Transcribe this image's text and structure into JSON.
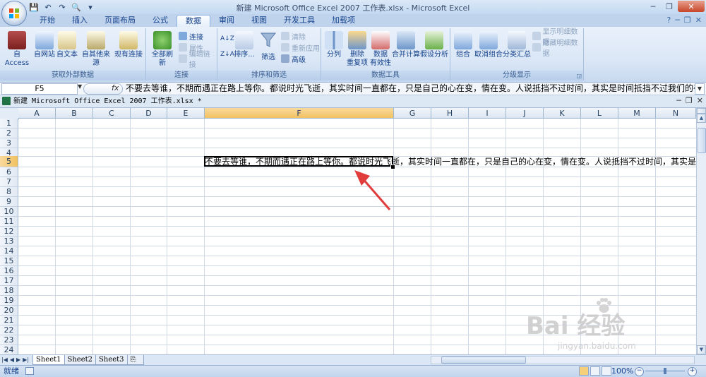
{
  "window": {
    "title": "新建 Microsoft Office Excel 2007 工作表.xlsx - Microsoft Excel",
    "minimize": "─",
    "maximize": "❐",
    "close": "✕"
  },
  "quick_access": [
    "💾",
    "↶",
    "↷",
    "🔍",
    "▾"
  ],
  "tabs": [
    {
      "label": "开始",
      "active": false
    },
    {
      "label": "插入",
      "active": false
    },
    {
      "label": "页面布局",
      "active": false
    },
    {
      "label": "公式",
      "active": false
    },
    {
      "label": "数据",
      "active": true
    },
    {
      "label": "审阅",
      "active": false
    },
    {
      "label": "视图",
      "active": false
    },
    {
      "label": "开发工具",
      "active": false
    },
    {
      "label": "加载项",
      "active": false
    }
  ],
  "help_icons": {
    "help": "?",
    "min": "─",
    "restore": "❐",
    "close": "✕"
  },
  "ribbon": {
    "get_external": {
      "label": "获取外部数据",
      "access": "自 Access",
      "web": "自网站",
      "text": "自文本",
      "other": "自其他来源",
      "existing": "现有连接"
    },
    "connections": {
      "label": "连接",
      "refresh_all": "全部刷新",
      "connections": "连接",
      "properties": "属性",
      "edit_links": "编辑链接"
    },
    "sort_filter": {
      "label": "排序和筛选",
      "sort": "排序...",
      "filter": "筛选",
      "clear": "清除",
      "reapply": "重新应用",
      "advanced": "高级",
      "az": "A↓Z",
      "za": "Z↓A"
    },
    "data_tools": {
      "label": "数据工具",
      "text_to_columns": "分列",
      "remove_dup_1": "删除",
      "remove_dup_2": "重复项",
      "validation_1": "数据",
      "validation_2": "有效性",
      "consolidate": "合并计算",
      "what_if": "假设分析"
    },
    "outline": {
      "label": "分级显示",
      "group": "组合",
      "ungroup": "取消组合",
      "subtotal": "分类汇总",
      "show_detail": "显示明细数据",
      "hide_detail": "隐藏明细数据"
    }
  },
  "formula_bar": {
    "name_box": "F5",
    "fx": "fx",
    "content": "不要去等谁，不期而遇正在路上等你。都说时光飞逝，其实时间一直都在，只是自己的心在变，情在变。人说抵挡不过时间，其实是时间抵挡不过我们的善变。"
  },
  "workbook": {
    "title": "新建 Microsoft Office Excel 2007 工作表.xlsx *"
  },
  "grid": {
    "columns": [
      "A",
      "B",
      "C",
      "D",
      "E",
      "F",
      "G",
      "H",
      "I",
      "J",
      "K",
      "L",
      "M",
      "N"
    ],
    "selected_column": "F",
    "rows": [
      "1",
      "2",
      "3",
      "4",
      "5",
      "6",
      "7",
      "8",
      "9",
      "10",
      "11",
      "12",
      "13",
      "14",
      "15",
      "16",
      "17",
      "18",
      "19",
      "20",
      "21",
      "22",
      "23",
      "24"
    ],
    "selected_row": "5",
    "cell_F5": "不要去等谁，不期而遇正在路上等你。都说时光飞逝，其实时间一直都在，只是自己的心在变，情在变。人说抵挡不过时间，其实是时间抵挡不过我们的善变。"
  },
  "sheets": [
    {
      "label": "Sheet1",
      "active": true
    },
    {
      "label": "Sheet2",
      "active": false
    },
    {
      "label": "Sheet3",
      "active": false
    }
  ],
  "status": {
    "mode": "就绪",
    "zoom": "100%",
    "minus": "−",
    "plus": "+"
  },
  "watermark": {
    "logo": "Bai 经验",
    "url": "jingyan.baidu.com"
  },
  "colors": {
    "accent": "#15428b",
    "selected_header": "#f1c15f",
    "arrow": "#e03c3c",
    "excel_green": "#217346"
  }
}
